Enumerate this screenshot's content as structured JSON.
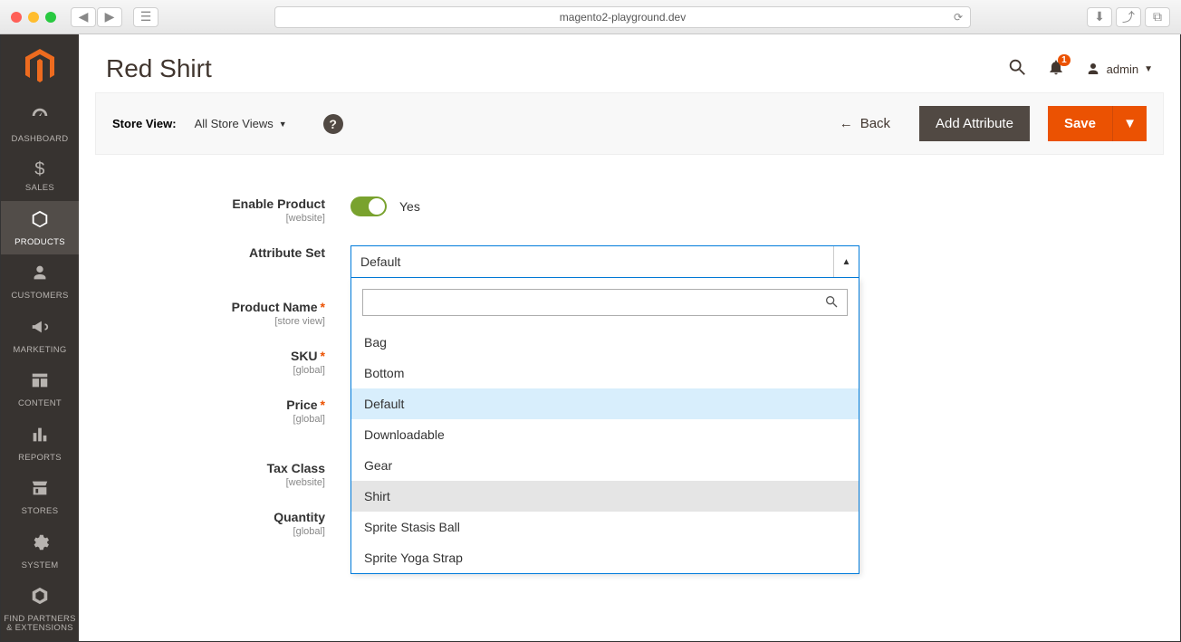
{
  "browser": {
    "url": "magento2-playground.dev"
  },
  "sidebar": {
    "items": [
      {
        "label": "DASHBOARD"
      },
      {
        "label": "SALES"
      },
      {
        "label": "PRODUCTS"
      },
      {
        "label": "CUSTOMERS"
      },
      {
        "label": "MARKETING"
      },
      {
        "label": "CONTENT"
      },
      {
        "label": "REPORTS"
      },
      {
        "label": "STORES"
      },
      {
        "label": "SYSTEM"
      },
      {
        "label": "FIND PARTNERS\n& EXTENSIONS"
      }
    ]
  },
  "header": {
    "page_title": "Red Shirt",
    "admin_user": "admin",
    "notifications_count": "1"
  },
  "toolbar": {
    "store_view_label": "Store View:",
    "store_view_value": "All Store Views",
    "back_label": "Back",
    "add_attribute_label": "Add Attribute",
    "save_label": "Save"
  },
  "form": {
    "enable_product": {
      "label": "Enable Product",
      "scope": "[website]",
      "value_label": "Yes",
      "value": true
    },
    "attribute_set": {
      "label": "Attribute Set",
      "value": "Default",
      "options": [
        "Bag",
        "Bottom",
        "Default",
        "Downloadable",
        "Gear",
        "Shirt",
        "Sprite Stasis Ball",
        "Sprite Yoga Strap"
      ],
      "selected": "Default",
      "hover": "Shirt"
    },
    "product_name": {
      "label": "Product Name",
      "scope": "[store view]",
      "required": true
    },
    "sku": {
      "label": "SKU",
      "scope": "[global]",
      "required": true
    },
    "price": {
      "label": "Price",
      "scope": "[global]",
      "required": true
    },
    "tax_class": {
      "label": "Tax Class",
      "scope": "[website]"
    },
    "quantity": {
      "label": "Quantity",
      "scope": "[global]"
    }
  }
}
